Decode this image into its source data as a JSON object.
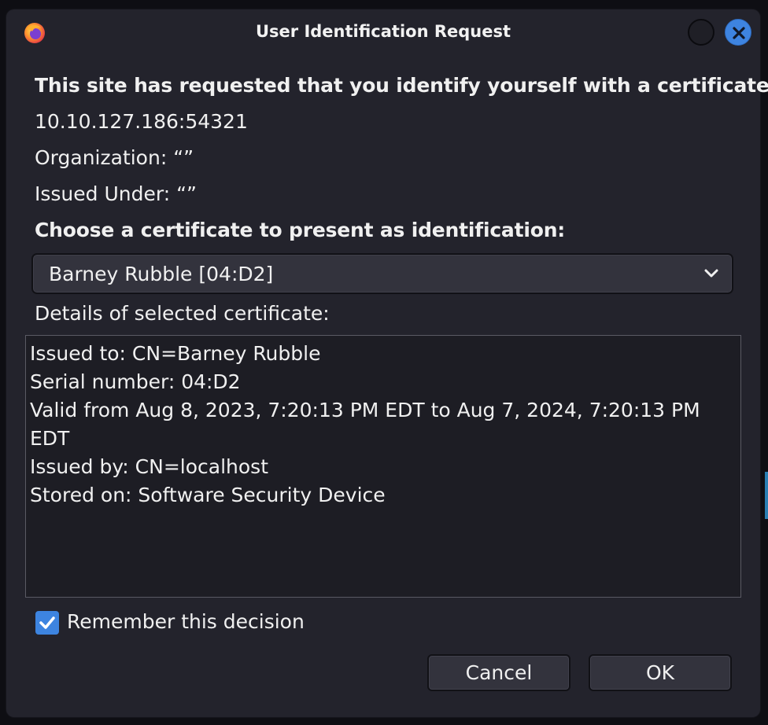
{
  "window": {
    "title": "User Identification Request",
    "app_icon": "firefox-icon",
    "controls": [
      "minimize-icon",
      "close-icon"
    ]
  },
  "content": {
    "heading": "This site has requested that you identify yourself with a certificate:",
    "host": "10.10.127.186:54321",
    "organization": "Organization: “”",
    "issued_under": "Issued Under: “”",
    "choose_label": "Choose a certificate to present as identification:",
    "selected_certificate": "Barney Rubble [04:D2]",
    "details_label": "Details of selected certificate:",
    "details": {
      "issued_to": "Issued to: CN=Barney Rubble",
      "serial": "Serial number: 04:D2",
      "valid_line1": "Valid from Aug 8, 2023, 7:20:13 PM EDT to Aug 7, 2024, 7:20:13 PM",
      "valid_line2": "EDT",
      "issued_by": "Issued by: CN=localhost",
      "stored_on": "Stored on: Software Security Device"
    },
    "remember_label": "Remember this decision",
    "remember_checked": true
  },
  "buttons": {
    "cancel": "Cancel",
    "ok": "OK"
  },
  "colors": {
    "dialog_bg": "#23232c",
    "accent": "#3e84e0",
    "text": "#f0f0f0"
  }
}
